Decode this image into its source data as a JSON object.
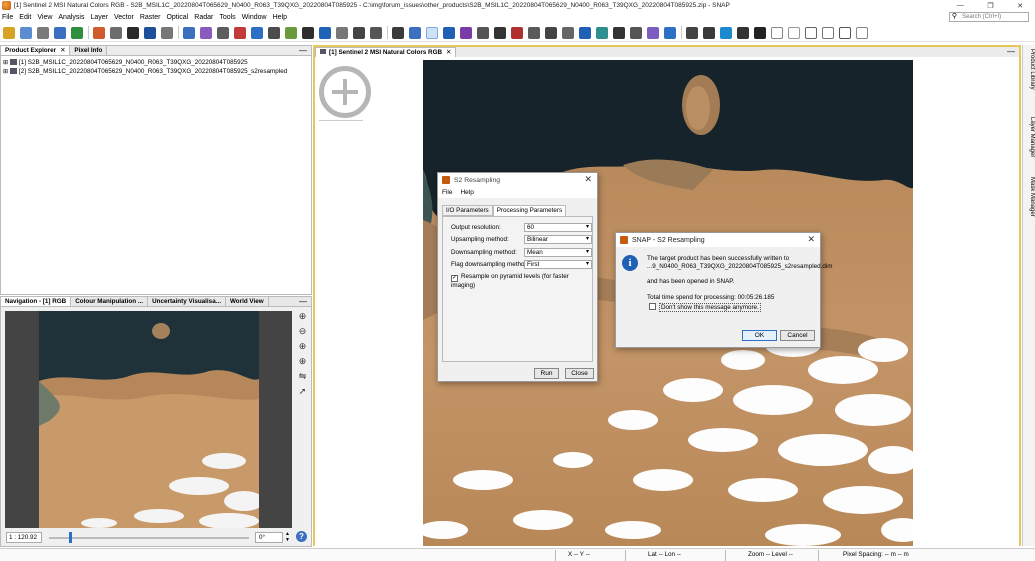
{
  "window": {
    "title": "[1] Sentinel 2 MSI Natural Colors RGB - S2B_MSIL1C_20220804T065629_N0400_R063_T39QXG_20220804T085925 - C:\\img\\forum_issues\\other_products\\S2B_MSIL1C_20220804T065629_N0400_R063_T39QXG_20220804T085925.zip - SNAP",
    "minimize": "—",
    "restore": "❐",
    "close": "✕"
  },
  "menu": [
    "File",
    "Edit",
    "View",
    "Analysis",
    "Layer",
    "Vector",
    "Raster",
    "Optical",
    "Radar",
    "Tools",
    "Window",
    "Help"
  ],
  "search": {
    "placeholder": "Search (Ctrl+I)",
    "icon": "magnifier-icon"
  },
  "product_panel": {
    "tabs": [
      "Product Explorer",
      "Pixel Info"
    ],
    "close": "✕",
    "minimize": "—",
    "items": [
      "[1] S2B_MSIL1C_20220804T065629_N0400_R063_T39QXG_20220804T085925",
      "[2] S2B_MSIL1C_20220804T065629_N0400_R063_T39QXG_20220804T085925_s2resampled"
    ]
  },
  "nav_panel": {
    "tabs": [
      "Navigation - [1] RGB",
      "Colour Manipulation ...",
      "Uncertainty Visualisa...",
      "World View"
    ],
    "minimize": "—",
    "scale": "1 : 120.92",
    "rotation": "0°",
    "slider_fraction": 0.1
  },
  "viewer": {
    "tab": "[1] Sentinel 2 MSI Natural Colors RGB",
    "close": "✕",
    "minimize": "—"
  },
  "right_rail": [
    "Product Library",
    "Layer Manager",
    "Mask Manager"
  ],
  "status": {
    "xy": "X -- Y --",
    "latlon": "Lat -- Lon --",
    "zoom": "Zoom -- Level --",
    "spacing": "Pixel Spacing: -- m -- m"
  },
  "resample_dialog": {
    "title": "S2 Resampling",
    "menu": [
      "File",
      "Help"
    ],
    "tabs": [
      "I/O Parameters",
      "Processing Parameters"
    ],
    "fields": [
      {
        "label": "Output resolution:",
        "value": "60"
      },
      {
        "label": "Upsampling method:",
        "value": "Bilinear"
      },
      {
        "label": "Downsampling method:",
        "value": "Mean"
      },
      {
        "label": "Flag downsampling method:",
        "value": "First"
      }
    ],
    "checkbox": "Resample on pyramid levels (for faster imaging)",
    "run": "Run",
    "close_btn": "Close"
  },
  "snap_dialog": {
    "title": "SNAP - S2 Resampling",
    "line1": "The target product has been successfully written to",
    "line2": "...9_N0400_R063_T39QXG_20220804T085925_s2resampled.dim",
    "line3": "and has been opened in SNAP.",
    "line4": "Total time spend for processing: 00:05:26.185",
    "checkbox": "Don't show this message anymore.",
    "ok": "OK",
    "cancel": "Cancel"
  },
  "colors": {
    "accent": "#2b6fc7",
    "viewer_border": "#e4c95a",
    "sea": "#1f3139",
    "desert": "#b5875a",
    "cloud": "#ffffff"
  }
}
